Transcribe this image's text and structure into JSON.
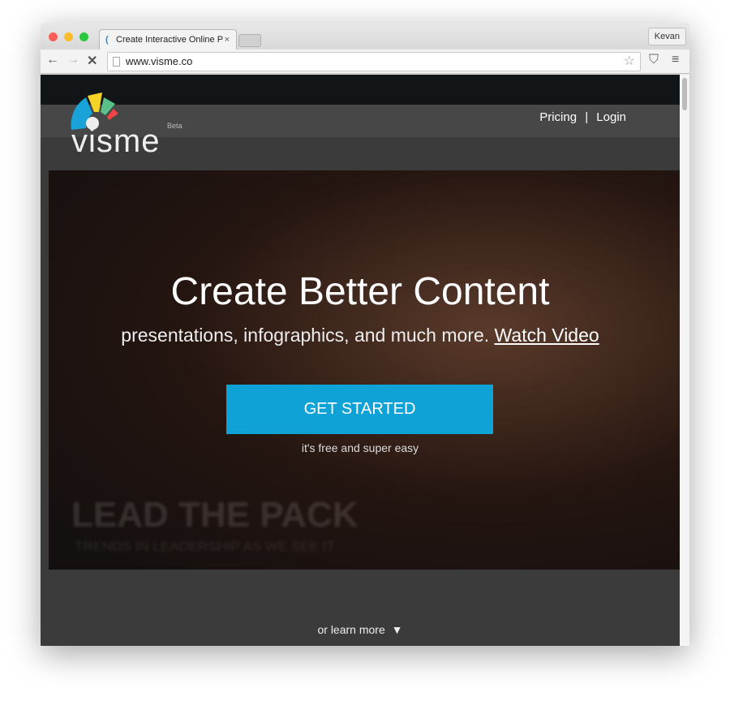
{
  "browser": {
    "tab_title": "Create Interactive Online P",
    "user": "Kevan",
    "url": "www.visme.co"
  },
  "site": {
    "logo": "visme",
    "beta": "Beta",
    "nav": {
      "pricing": "Pricing",
      "sep": "|",
      "login": "Login"
    },
    "hero": {
      "title": "Create Better Content",
      "subtitle": "presentations, infographics, and much more.",
      "watch": "Watch Video",
      "cta": "GET STARTED",
      "note": "it's free and super easy",
      "bg_title": "LEAD THE PACK",
      "bg_sub": "TRENDS IN LEADERSHIP AS WE SEE IT"
    },
    "learn_more": "or learn more"
  },
  "colors": {
    "accent": "#0ea2d6"
  }
}
